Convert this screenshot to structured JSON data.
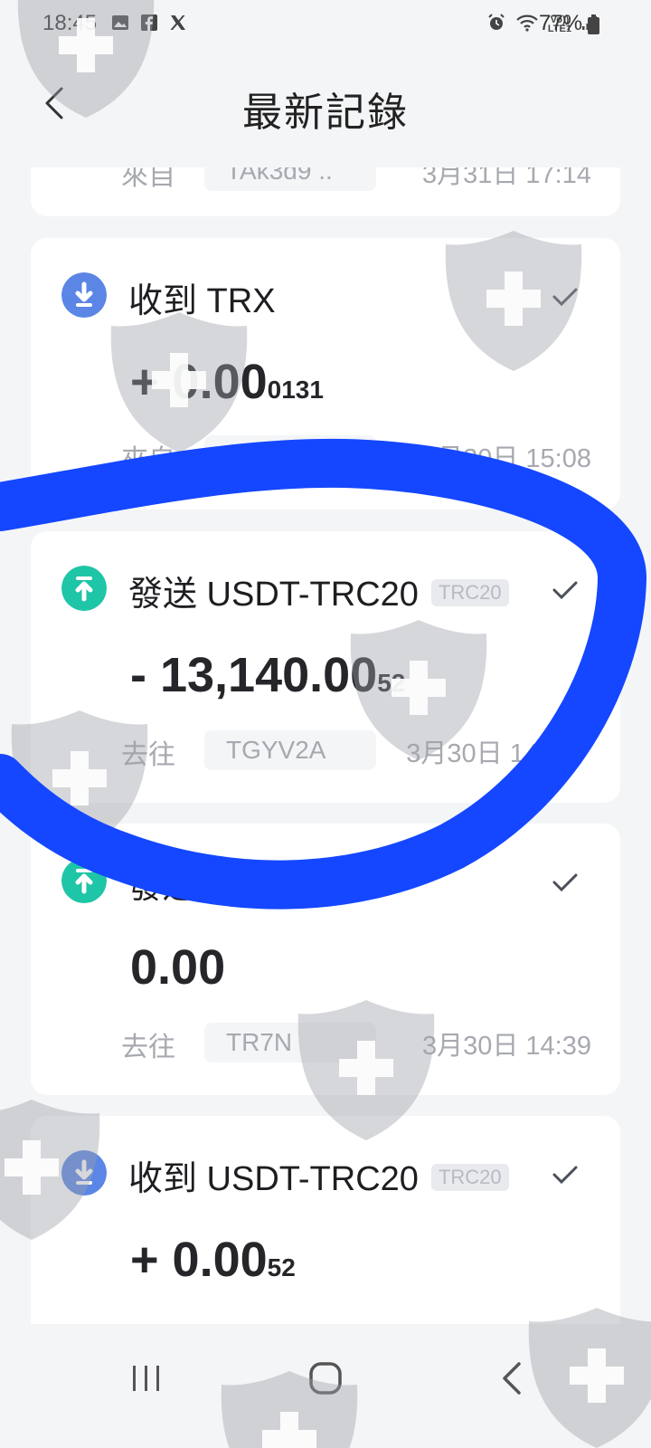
{
  "status_bar": {
    "time": "18:45",
    "left_icons": [
      "gallery-icon",
      "facebook-icon",
      "x-icon"
    ],
    "right_icons": [
      "alarm-icon",
      "wifi-icon",
      "volte-icon",
      "signal-icon"
    ],
    "network_label": "VoLTE1",
    "battery": "77%"
  },
  "header": {
    "title": "最新記錄",
    "back_icon": "chevron-left-icon"
  },
  "transactions": [
    {
      "label": "來自",
      "address": "TAk3d9 ..",
      "time": "3月31日 17:14"
    },
    {
      "direction": "in",
      "title": "收到 TRX",
      "amount_main": "+ 0.00",
      "amount_small": "0131",
      "label": "來自",
      "address": "TAk",
      "time": "3月30日 15:08"
    },
    {
      "direction": "out",
      "title": "發送 USDT-TRC20",
      "badge": "TRC20",
      "amount_main": "- 13,140.00",
      "amount_small": "52",
      "label": "去往",
      "address": "TGYV2A",
      "time": "3月30日 14"
    },
    {
      "direction": "out",
      "title": "發送 ",
      "amount_main": "0.00",
      "amount_small": "",
      "label": "去往",
      "address": "TR7N",
      "time": "3月30日 14:39"
    },
    {
      "direction": "in",
      "title": "收到 USDT-TRC20",
      "badge": "TRC20",
      "amount_main": "+ 0.00",
      "amount_small": "52"
    }
  ],
  "colors": {
    "receive_icon": "#5b86e5",
    "send_icon": "#1fc5a7",
    "annotation_stroke": "#1447ff",
    "watermark": "#9aa0a8"
  },
  "nav_bar": {
    "icons": [
      "recents-icon",
      "home-icon",
      "back-icon"
    ]
  }
}
